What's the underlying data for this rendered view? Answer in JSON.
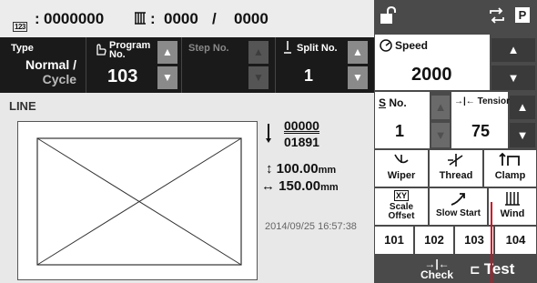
{
  "header": {
    "counter_icon_label": "123",
    "counter_value": "0000000",
    "bobbin_value": "0000",
    "separator": "/",
    "bobbin_total": "0000"
  },
  "params": {
    "type_label": "Type",
    "type_value_line1": "Normal /",
    "type_value_line2": "Cycle",
    "program_label_line1": "Program",
    "program_label_line2": "No.",
    "program_value": "103",
    "step_label": "Step No.",
    "split_label": "Split No.",
    "split_value": "1",
    "up_arrow": "▲",
    "down_arrow": "▼"
  },
  "main": {
    "line_label": "LINE",
    "stitch_count": "00000",
    "stitch_total": "01891",
    "height_value": "100.00",
    "width_value": "150.00",
    "unit": "mm",
    "height_icon": "↕",
    "width_icon": "↔",
    "datetime": "2014/09/25 16:57:38"
  },
  "right": {
    "speed_label": "Speed",
    "speed_value": "2000",
    "s_no_label": "No.",
    "s_no_value": "1",
    "tension_label": "Tension",
    "tension_value": "75",
    "wiper_label": "Wiper",
    "thread_label": "Thread",
    "clamp_label": "Clamp",
    "scale_offset_line1": "Scale",
    "scale_offset_line2": "Offset",
    "xy_label": "XY",
    "slow_start_label": "Slow Start",
    "wind_label": "Wind",
    "programs": [
      "101",
      "102",
      "103",
      "104"
    ],
    "check_label": "Check",
    "test_label": "Test"
  },
  "colors": {
    "panel_dark": "#1a1a1a",
    "right_panel": "#4a4a4a",
    "marker_line": "#cc1122"
  }
}
